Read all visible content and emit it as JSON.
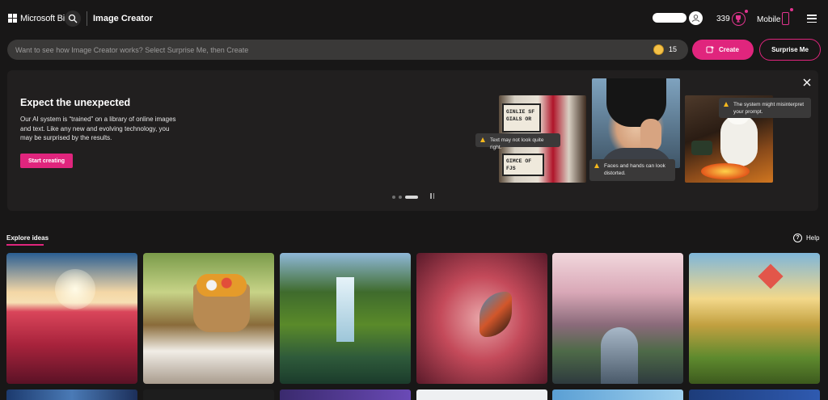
{
  "header": {
    "brand": "Microsoft Bing",
    "app_title": "Image Creator",
    "points": "339",
    "mobile_label": "Mobile"
  },
  "prompt": {
    "placeholder": "Want to see how Image Creator works? Select Surprise Me, then Create",
    "boosts": "15",
    "create_label": "Create",
    "surprise_label": "Surprise Me"
  },
  "banner": {
    "title": "Expect the unexpected",
    "description": "Our AI system is “trained” on a library of online images and text. Like any new and evolving technology, you may be surprised by the results.",
    "cta": "Start creating",
    "warnings": {
      "text": "Text may not look quite right.",
      "faces": "Faces and hands can look distorted.",
      "interpret": "The system might misinterpret your prompt."
    },
    "carousel": {
      "slides": 3,
      "active_index": 2
    },
    "images": {
      "gas_top": "GINLIE SF GIALS OR",
      "gas_bottom": "GIMCE OF FJS"
    }
  },
  "explore": {
    "title": "Explore ideas",
    "help_label": "Help"
  },
  "colors": {
    "accent": "#e0257d",
    "background": "#181717",
    "banner_bg": "#211f1f",
    "warning": "#f5b81c"
  },
  "icons": [
    "search-icon",
    "user-icon",
    "rewards-icon",
    "phone-icon",
    "menu-icon",
    "coin-icon",
    "create-icon",
    "close-icon",
    "warning-icon",
    "pause-icon",
    "help-icon"
  ]
}
